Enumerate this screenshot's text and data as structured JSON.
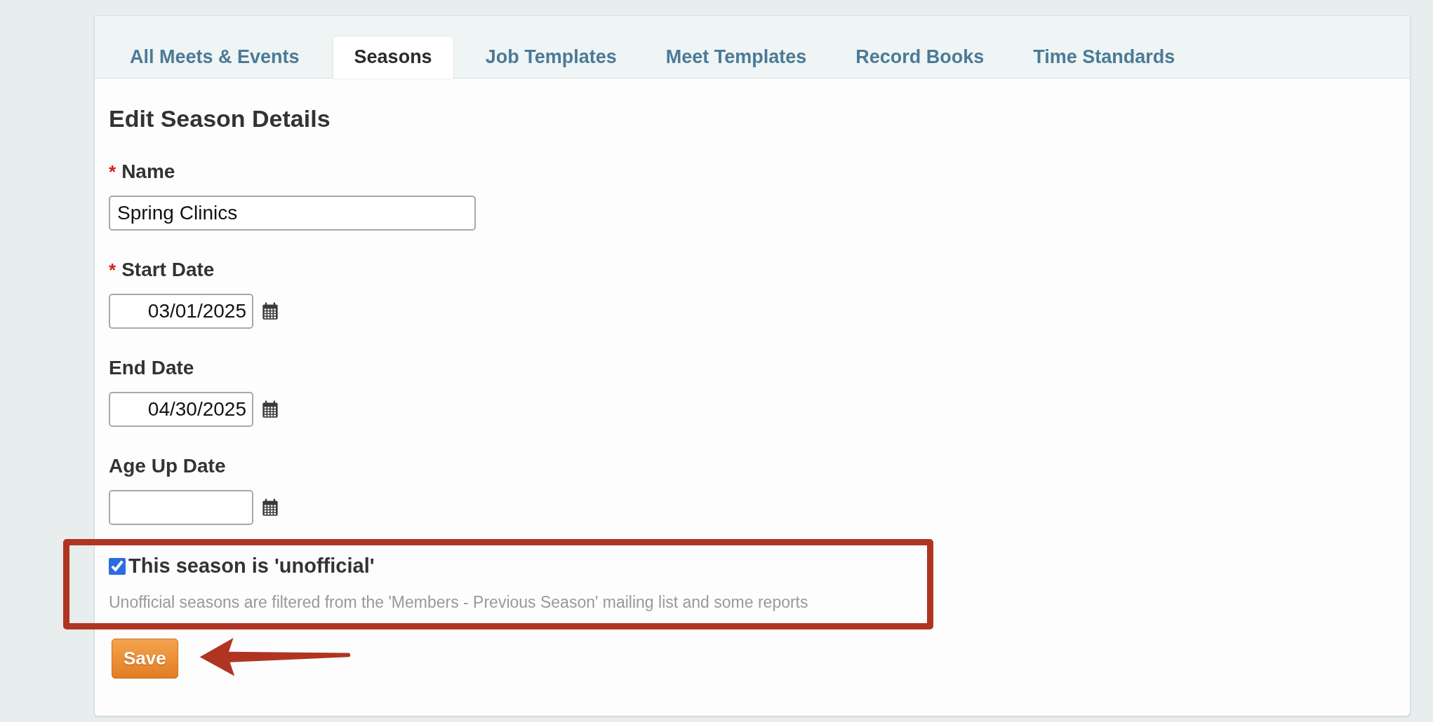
{
  "tabs": [
    {
      "label": "All Meets & Events",
      "selected": false
    },
    {
      "label": "Seasons",
      "selected": true
    },
    {
      "label": "Job Templates",
      "selected": false
    },
    {
      "label": "Meet Templates",
      "selected": false
    },
    {
      "label": "Record Books",
      "selected": false
    },
    {
      "label": "Time Standards",
      "selected": false
    }
  ],
  "form": {
    "heading": "Edit Season Details",
    "fields": [
      {
        "kind": "text",
        "label": "Name",
        "required_mark": "*",
        "value": "Spring Clinics"
      },
      {
        "kind": "date",
        "label": "Start Date",
        "required_mark": "*",
        "value": "03/01/2025"
      },
      {
        "kind": "date",
        "label": "End Date",
        "value": "04/30/2025"
      },
      {
        "kind": "date",
        "label": "Age Up Date"
      }
    ],
    "checkbox": {
      "label": "This season is 'unofficial'",
      "checked": true,
      "help": "Unofficial seasons are filtered from the 'Members - Previous Season' mailing list and some reports"
    },
    "save_button": "Save"
  }
}
